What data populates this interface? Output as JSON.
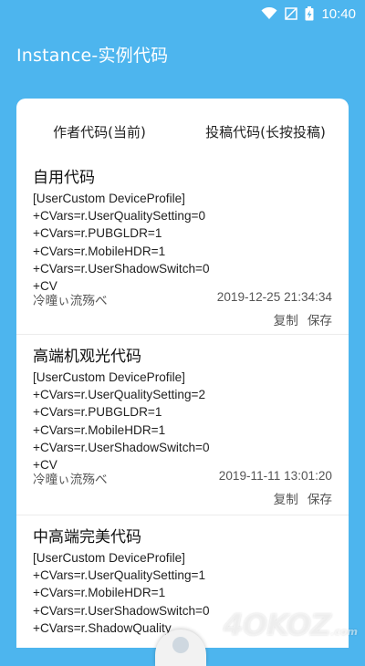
{
  "status_bar": {
    "time": "10:40",
    "icons": [
      "wifi-icon",
      "no-signal-icon",
      "battery-charging-icon"
    ]
  },
  "app": {
    "title": "Instance-实例代码"
  },
  "tabs": [
    {
      "label": "作者代码(当前)",
      "active": true
    },
    {
      "label": "投稿代码(长按投稿)",
      "active": false
    }
  ],
  "entries": [
    {
      "title": "自用代码",
      "code": "[UserCustom DeviceProfile]\n+CVars=r.UserQualitySetting=0\n+CVars=r.PUBGLDR=1\n+CVars=r.MobileHDR=1\n+CVars=r.UserShadowSwitch=0\n+CV",
      "author": "冷曈ぃ流殇べ",
      "date": "2019-12-25 21:34:34",
      "copy_label": "复制",
      "save_label": "保存"
    },
    {
      "title": "高端机观光代码",
      "code": "[UserCustom DeviceProfile]\n+CVars=r.UserQualitySetting=2\n+CVars=r.PUBGLDR=1\n+CVars=r.MobileHDR=1\n+CVars=r.UserShadowSwitch=0\n+CV",
      "author": "冷曈ぃ流殇べ",
      "date": "2019-11-11 13:01:20",
      "copy_label": "复制",
      "save_label": "保存"
    },
    {
      "title": "中高端完美代码",
      "code": "[UserCustom DeviceProfile]\n+CVars=r.UserQualitySetting=1\n+CVars=r.MobileHDR=1\n+CVars=r.UserShadowSwitch=0\n+CVars=r.ShadowQuality"
    }
  ],
  "watermark": {
    "text": "4OKOZ",
    "suffix": ".com"
  },
  "colors": {
    "background": "#4db5ee",
    "card": "#ffffff"
  }
}
